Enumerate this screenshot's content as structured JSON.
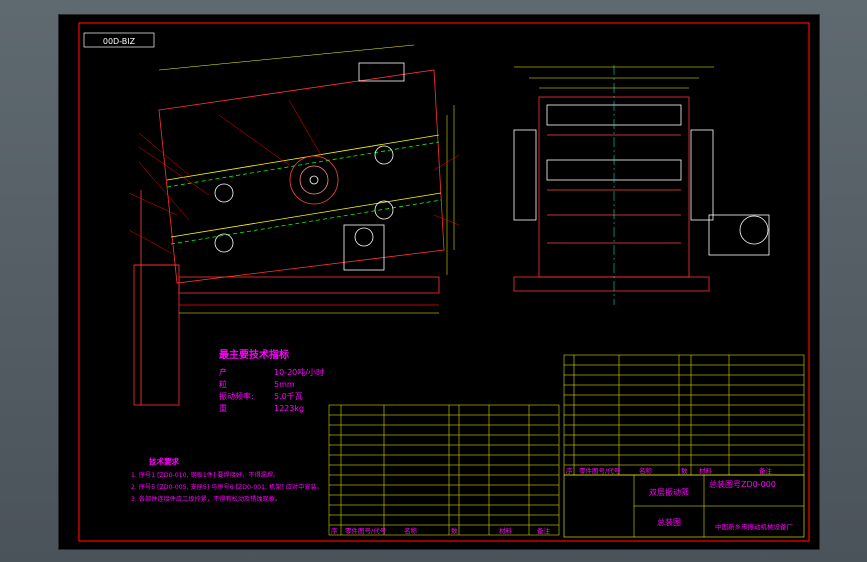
{
  "drawing_code": "00D-BIZ",
  "spec_title": "最主要技术指标",
  "specs": [
    {
      "label": "产",
      "value": "10-20吨/小时"
    },
    {
      "label": "粒",
      "value": "5mm"
    },
    {
      "label": "振动频率:",
      "value": "5.0千瓦"
    },
    {
      "label": "重",
      "value": "1223kg"
    }
  ],
  "tech_title": "技术要求",
  "tech_notes": [
    "1. 序号1 [ZD0-010, 钢板1件] 要焊接好，不得漏焊。",
    "2. 序号5 [ZD0-005, 支座5] 与序号6 [ZD0-001, 机架] 应对中安装。",
    "3. 各部件连接件应二级拧紧，不得有松动及锈蚀现象。"
  ],
  "title_block": {
    "name": "双层振动筛",
    "drawing_no": "总装图号ZD0-000",
    "assembly": "总装图",
    "company": "中国新乡市振动机械设备厂",
    "header_cols": [
      "序",
      "零件图号/代号",
      "名称",
      "数",
      "材料",
      "备注"
    ]
  },
  "colors": {
    "frame": "#ff0000",
    "drawing": "#ff3333",
    "table_line": "#ffff00",
    "table_text": "#ff00ff",
    "centerline": "#00ffff",
    "accent": "#00ff00"
  }
}
